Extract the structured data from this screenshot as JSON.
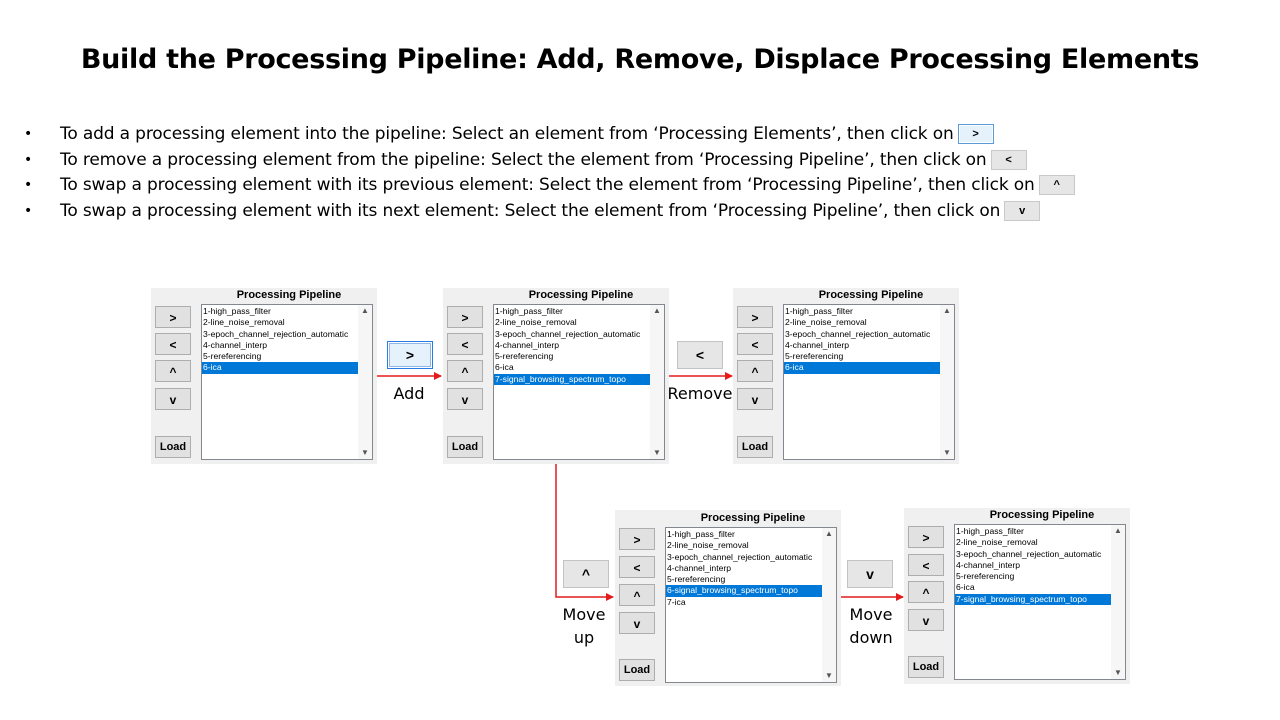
{
  "title": "Build the Processing Pipeline: Add, Remove, Displace Processing Elements",
  "bullets": [
    {
      "text": "To add a processing element into the pipeline: Select an element from ‘Processing Elements’, then click on",
      "button": ">"
    },
    {
      "text": "To remove a processing element from the pipeline: Select the element from ‘Processing Pipeline’, then click on",
      "button": "<"
    },
    {
      "text": "To swap a processing element with its previous element: Select the element from ‘Processing Pipeline’, then click on",
      "button": "^"
    },
    {
      "text": "To swap a processing element with its next element: Select the element from ‘Processing Pipeline’, then click on",
      "button": "v"
    }
  ],
  "bullet_mark": "•",
  "panel_title": "Processing Pipeline",
  "panel_buttons": {
    "add": ">",
    "remove": "<",
    "up": "^",
    "down": "v",
    "load": "Load"
  },
  "scroll": {
    "up": "▲",
    "down": "▼"
  },
  "panels": [
    {
      "items": [
        "1-high_pass_filter",
        "2-line_noise_removal",
        "3-epoch_channel_rejection_automatic",
        "4-channel_interp",
        "5-rereferencing",
        "6-ica"
      ],
      "selected": 5
    },
    {
      "items": [
        "1-high_pass_filter",
        "2-line_noise_removal",
        "3-epoch_channel_rejection_automatic",
        "4-channel_interp",
        "5-rereferencing",
        "6-ica",
        "7-signal_browsing_spectrum_topo"
      ],
      "selected": 6
    },
    {
      "items": [
        "1-high_pass_filter",
        "2-line_noise_removal",
        "3-epoch_channel_rejection_automatic",
        "4-channel_interp",
        "5-rereferencing",
        "6-ica"
      ],
      "selected": 5
    },
    {
      "items": [
        "1-high_pass_filter",
        "2-line_noise_removal",
        "3-epoch_channel_rejection_automatic",
        "4-channel_interp",
        "5-rereferencing",
        "6-signal_browsing_spectrum_topo",
        "7-ica"
      ],
      "selected": 5
    },
    {
      "items": [
        "1-high_pass_filter",
        "2-line_noise_removal",
        "3-epoch_channel_rejection_automatic",
        "4-channel_interp",
        "5-rereferencing",
        "6-ica",
        "7-signal_browsing_spectrum_topo"
      ],
      "selected": 6
    }
  ],
  "actions": [
    {
      "button": ">",
      "label": "Add"
    },
    {
      "button": "<",
      "label": "Remove"
    },
    {
      "button": "^",
      "label": "Move up"
    },
    {
      "button": "v",
      "label": "Move down"
    }
  ],
  "colors": {
    "arrow": "#e31b1b",
    "selection": "#0078d7"
  }
}
